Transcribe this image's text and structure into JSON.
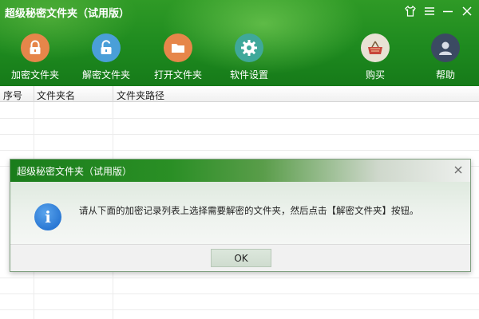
{
  "window": {
    "title": "超级秘密文件夹（试用版）",
    "controls": [
      "shirt-icon",
      "menu-icon",
      "minimize-icon",
      "close-icon"
    ]
  },
  "toolbar": {
    "items": [
      {
        "label": "加密文件夹",
        "icon": "lock-closed-icon",
        "color": "#e6864a"
      },
      {
        "label": "解密文件夹",
        "icon": "lock-open-icon",
        "color": "#4a9fd8"
      },
      {
        "label": "打开文件夹",
        "icon": "folder-icon",
        "color": "#e6864a"
      },
      {
        "label": "软件设置",
        "icon": "gear-icon",
        "color": "#3fa89a"
      },
      {
        "label": "购买",
        "icon": "basket-icon",
        "color": "#e8e2d4"
      },
      {
        "label": "帮助",
        "icon": "user-icon",
        "color": "#3b4a62"
      }
    ]
  },
  "table": {
    "columns": [
      "序号",
      "文件夹名",
      "文件夹路径"
    ],
    "rows": []
  },
  "dialog": {
    "title": "超级秘密文件夹（试用版）",
    "icon": "info-icon",
    "message": "请从下面的加密记录列表上选择需要解密的文件夹，然后点击【解密文件夹】按钮。",
    "ok_label": "OK"
  },
  "colors": {
    "header_green": "#1e8a1f",
    "info_blue": "#2a78d4"
  }
}
